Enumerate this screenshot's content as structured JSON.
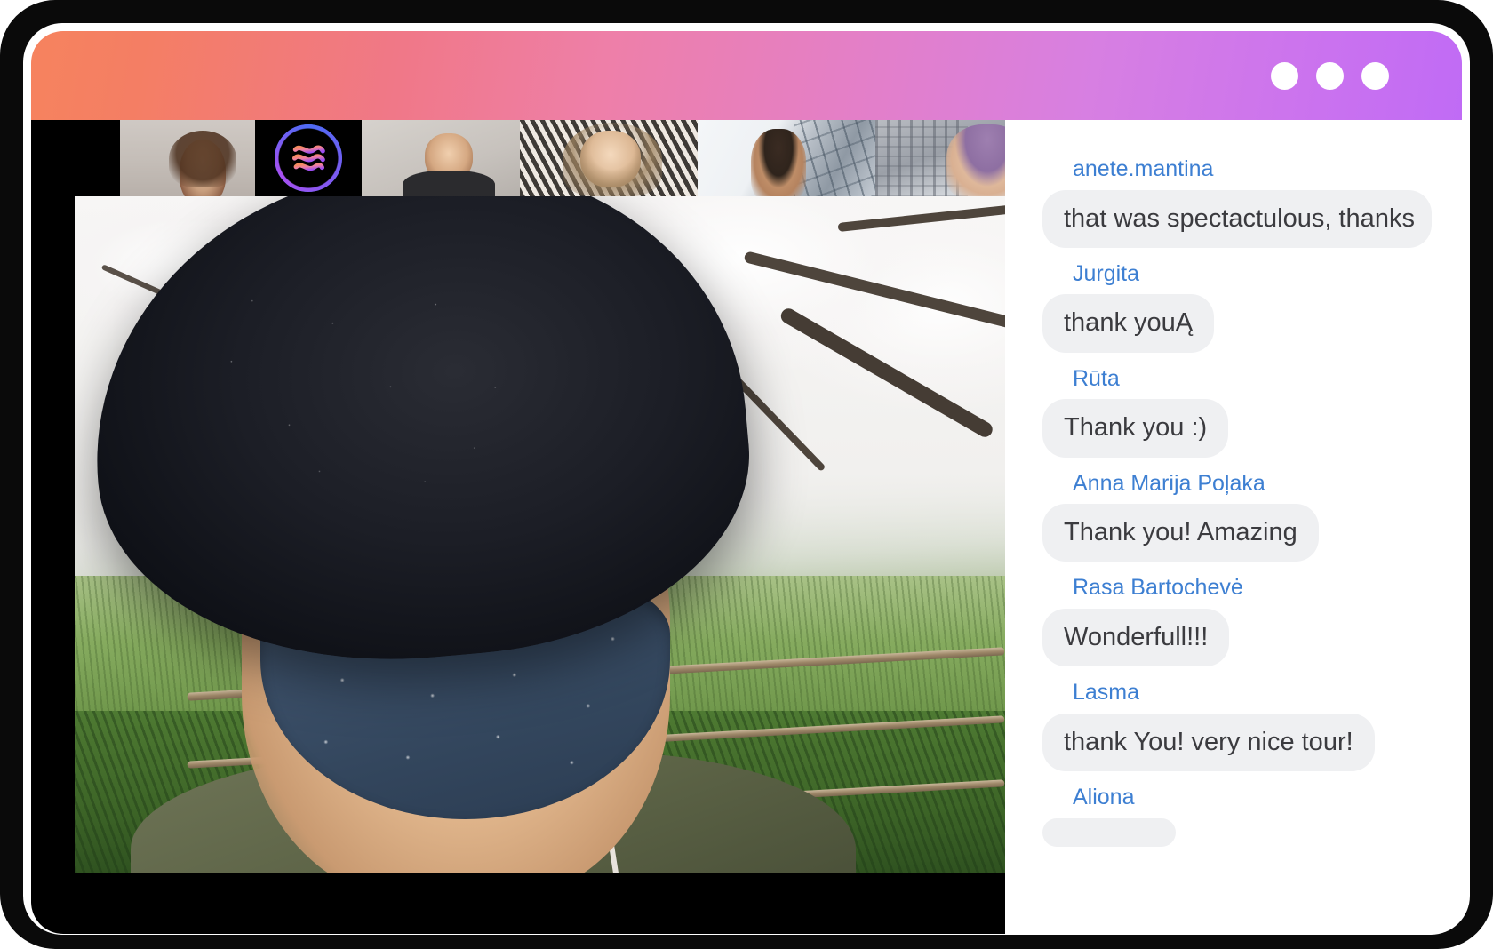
{
  "window": {
    "controls": [
      {
        "name": "window-control-1"
      },
      {
        "name": "window-control-2"
      },
      {
        "name": "window-control-3"
      }
    ],
    "titlebar_gradient_from": "#f6835e",
    "titlebar_gradient_mid": "#ee7fa8",
    "titlebar_gradient_to": "#c06bf5"
  },
  "filmstrip": {
    "tiles": [
      {
        "id": "tile-blank",
        "kind": "blank",
        "label": ""
      },
      {
        "id": "tile-woman-1",
        "kind": "camera",
        "label": ""
      },
      {
        "id": "tile-logo",
        "kind": "avatar",
        "label": ""
      },
      {
        "id": "tile-man-1",
        "kind": "camera",
        "label": ""
      },
      {
        "id": "tile-woman-2",
        "kind": "camera",
        "label": ""
      },
      {
        "id": "tile-man-2",
        "kind": "camera",
        "label": ""
      },
      {
        "id": "tile-person-3",
        "kind": "camera",
        "label": ""
      }
    ]
  },
  "stage": {
    "active_speaker_tile": "main-video"
  },
  "chat": {
    "name_color": "#3d7fd2",
    "bubble_color": "#eff0f2",
    "text_color": "#3b3b3f",
    "messages": [
      {
        "author": "anete.mantina",
        "text": "that was spectactulous, thanks"
      },
      {
        "author": "Jurgita",
        "text": "thank youĄ"
      },
      {
        "author": "Rūta",
        "text": "Thank you :)"
      },
      {
        "author": "Anna Marija Poļaka",
        "text": "Thank you! Amazing"
      },
      {
        "author": "Rasa Bartochevė",
        "text": "Wonderfull!!!"
      },
      {
        "author": "Lasma",
        "text": "thank You! very nice tour!"
      },
      {
        "author": "Aliona",
        "text": ""
      }
    ]
  }
}
